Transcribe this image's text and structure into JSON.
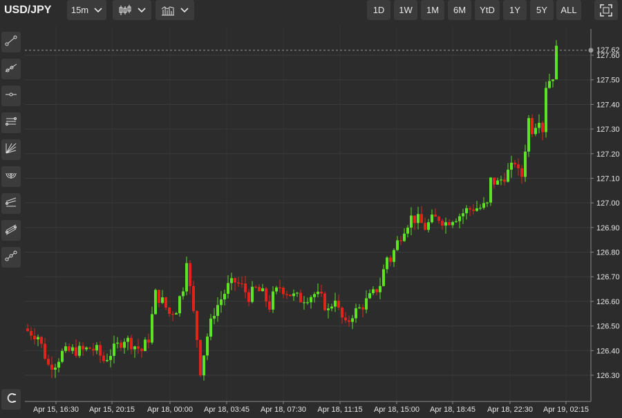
{
  "symbol": "USD/JPY",
  "toolbar": {
    "interval": "15m",
    "chart_type_icon": "candlestick-icon",
    "indicators_icon": "indicators-icon",
    "fullscreen_icon": "fullscreen-icon",
    "ranges": [
      "1D",
      "1W",
      "1M",
      "6M",
      "YtD",
      "1Y",
      "5Y",
      "ALL"
    ]
  },
  "drawing_tools": [
    "trend-line-icon",
    "ray-icon",
    "horizontal-line-icon",
    "parallel-channel-icon",
    "fan-icon",
    "arc-icon",
    "pitchfork-icon",
    "regression-icon",
    "path-icon"
  ],
  "magnet_icon": "magnet-icon",
  "colors": {
    "background": "#2b2c2b",
    "up": "#5ee224",
    "down": "#e0241b",
    "axis_text": "#e6e6e6",
    "price_line": "#9a9a9a"
  },
  "chart_data": {
    "type": "candlestick",
    "title": "",
    "xlabel": "",
    "ylabel": "",
    "ylim": [
      126.19,
      127.73
    ],
    "x_ticks": [
      "Apr 15, 16:30",
      "Apr 15, 20:15",
      "Apr 18, 00:00",
      "Apr 18, 03:45",
      "Apr 18, 07:30",
      "Apr 18, 11:15",
      "Apr 18, 15:00",
      "Apr 18, 18:45",
      "Apr 18, 22:30",
      "Apr 19, 02:15"
    ],
    "y_ticks": [
      "126.30",
      "126.40",
      "126.50",
      "126.60",
      "126.70",
      "126.80",
      "126.90",
      "127.00",
      "127.10",
      "127.20",
      "127.30",
      "127.40",
      "127.50",
      "127.60"
    ],
    "last_price": "127.62",
    "grid": true,
    "close_path": [
      [
        0,
        126.48
      ],
      [
        3,
        126.46
      ],
      [
        5,
        126.38
      ],
      [
        6,
        126.34
      ],
      [
        8,
        126.35
      ],
      [
        10,
        126.39
      ],
      [
        13,
        126.4
      ],
      [
        16,
        126.4
      ],
      [
        18,
        126.41
      ],
      [
        20,
        126.4
      ],
      [
        22,
        126.36
      ],
      [
        24,
        126.39
      ],
      [
        26,
        126.42
      ],
      [
        28,
        126.45
      ],
      [
        30,
        126.43
      ],
      [
        33,
        126.4
      ],
      [
        35,
        126.45
      ],
      [
        37,
        126.63
      ],
      [
        39,
        126.6
      ],
      [
        41,
        126.55
      ],
      [
        43,
        126.57
      ],
      [
        45,
        126.66
      ],
      [
        46,
        126.78
      ],
      [
        47,
        126.65
      ],
      [
        49,
        126.45
      ],
      [
        50,
        126.32
      ],
      [
        52,
        126.46
      ],
      [
        54,
        126.56
      ],
      [
        56,
        126.61
      ],
      [
        58,
        126.66
      ],
      [
        60,
        126.68
      ],
      [
        62,
        126.66
      ],
      [
        64,
        126.62
      ],
      [
        66,
        126.65
      ],
      [
        68,
        126.63
      ],
      [
        70,
        126.58
      ],
      [
        71,
        126.62
      ],
      [
        73,
        126.66
      ],
      [
        75,
        126.64
      ],
      [
        77,
        126.62
      ],
      [
        79,
        126.61
      ],
      [
        81,
        126.62
      ],
      [
        83,
        126.63
      ],
      [
        85,
        126.61
      ],
      [
        87,
        126.56
      ],
      [
        89,
        126.62
      ],
      [
        90,
        126.56
      ],
      [
        92,
        126.5
      ],
      [
        94,
        126.55
      ],
      [
        96,
        126.57
      ],
      [
        98,
        126.6
      ],
      [
        100,
        126.63
      ],
      [
        102,
        126.67
      ],
      [
        104,
        126.78
      ],
      [
        105,
        126.77
      ],
      [
        107,
        126.84
      ],
      [
        109,
        126.9
      ],
      [
        111,
        126.94
      ],
      [
        113,
        126.93
      ],
      [
        115,
        126.9
      ],
      [
        117,
        126.93
      ],
      [
        119,
        126.94
      ],
      [
        121,
        126.92
      ],
      [
        123,
        126.94
      ],
      [
        125,
        126.95
      ],
      [
        127,
        126.97
      ],
      [
        129,
        126.98
      ],
      [
        131,
        126.98
      ],
      [
        133,
        126.99
      ],
      [
        134,
        127.09
      ],
      [
        136,
        127.08
      ],
      [
        138,
        127.11
      ],
      [
        140,
        127.14
      ],
      [
        141,
        127.17
      ],
      [
        142,
        127.12
      ],
      [
        143,
        127.11
      ],
      [
        145,
        127.34
      ],
      [
        146,
        127.3
      ],
      [
        148,
        127.35
      ],
      [
        149,
        127.3
      ],
      [
        150,
        127.48
      ],
      [
        152,
        127.52
      ],
      [
        153,
        127.62
      ]
    ]
  }
}
